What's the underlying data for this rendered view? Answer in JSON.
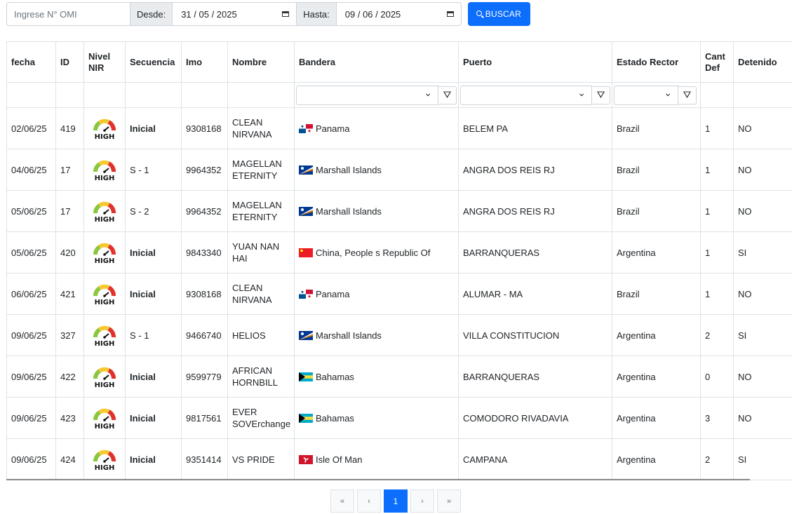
{
  "search": {
    "omi_placeholder": "Ingrese N° OMI",
    "desde_label": "Desde:",
    "desde_value": "31 / 05 / 2025",
    "hasta_label": "Hasta:",
    "hasta_value": "09 / 06 / 2025",
    "button_label": "BUSCAR"
  },
  "table": {
    "headers": [
      "fecha",
      "ID",
      "Nivel NIR",
      "Secuencia",
      "Imo",
      "Nombre",
      "Bandera",
      "Puerto",
      "Estado Rector",
      "Cant Def",
      "Detenido"
    ],
    "rows": [
      {
        "fecha": "02/06/25",
        "id": "419",
        "nir": "HIGH",
        "secuencia": "Inicial",
        "imo": "9308168",
        "nombre": "CLEAN NIRVANA",
        "bandera": "Panama",
        "flag": "panama",
        "puerto": "BELEM PA",
        "estado": "Brazil",
        "cant": "1",
        "detenido": "NO"
      },
      {
        "fecha": "04/06/25",
        "id": "17",
        "nir": "HIGH",
        "secuencia": "S - 1",
        "imo": "9964352",
        "nombre": "MAGELLAN ETERNITY",
        "bandera": "Marshall Islands",
        "flag": "marshall",
        "puerto": "ANGRA DOS REIS RJ",
        "estado": "Brazil",
        "cant": "1",
        "detenido": "NO"
      },
      {
        "fecha": "05/06/25",
        "id": "17",
        "nir": "HIGH",
        "secuencia": "S - 2",
        "imo": "9964352",
        "nombre": "MAGELLAN ETERNITY",
        "bandera": "Marshall Islands",
        "flag": "marshall",
        "puerto": "ANGRA DOS REIS RJ",
        "estado": "Brazil",
        "cant": "1",
        "detenido": "NO"
      },
      {
        "fecha": "05/06/25",
        "id": "420",
        "nir": "HIGH",
        "secuencia": "Inicial",
        "imo": "9843340",
        "nombre": "YUAN NAN HAI",
        "bandera": "China, People s Republic Of",
        "flag": "china",
        "puerto": "BARRANQUERAS",
        "estado": "Argentina",
        "cant": "1",
        "detenido": "SI"
      },
      {
        "fecha": "06/06/25",
        "id": "421",
        "nir": "HIGH",
        "secuencia": "Inicial",
        "imo": "9308168",
        "nombre": "CLEAN NIRVANA",
        "bandera": "Panama",
        "flag": "panama",
        "puerto": "ALUMAR - MA",
        "estado": "Brazil",
        "cant": "1",
        "detenido": "NO"
      },
      {
        "fecha": "09/06/25",
        "id": "327",
        "nir": "HIGH",
        "secuencia": "S - 1",
        "imo": "9466740",
        "nombre": "HELIOS",
        "bandera": "Marshall Islands",
        "flag": "marshall",
        "puerto": "VILLA CONSTITUCION",
        "estado": "Argentina",
        "cant": "2",
        "detenido": "SI"
      },
      {
        "fecha": "09/06/25",
        "id": "422",
        "nir": "HIGH",
        "secuencia": "Inicial",
        "imo": "9599779",
        "nombre": "AFRICAN HORNBILL",
        "bandera": "Bahamas",
        "flag": "bahamas",
        "puerto": "BARRANQUERAS",
        "estado": "Argentina",
        "cant": "0",
        "detenido": "NO"
      },
      {
        "fecha": "09/06/25",
        "id": "423",
        "nir": "HIGH",
        "secuencia": "Inicial",
        "imo": "9817561",
        "nombre": "EVER SOVErchange",
        "bandera": "Bahamas",
        "flag": "bahamas",
        "puerto": "COMODORO RIVADAVIA",
        "estado": "Argentina",
        "cant": "3",
        "detenido": "NO"
      },
      {
        "fecha": "09/06/25",
        "id": "424",
        "nir": "HIGH",
        "secuencia": "Inicial",
        "imo": "9351414",
        "nombre": "VS PRIDE",
        "bandera": "Isle Of Man",
        "flag": "isleofman",
        "puerto": "CAMPANA",
        "estado": "Argentina",
        "cant": "2",
        "detenido": "SI"
      }
    ]
  },
  "pagination": {
    "first": "«",
    "prev": "‹",
    "current": "1",
    "next": "›",
    "last": "»"
  },
  "colors": {
    "primary": "#0d6efd",
    "border": "#dee2e6"
  }
}
